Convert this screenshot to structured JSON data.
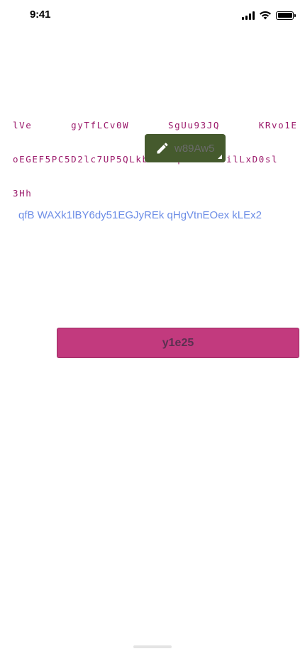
{
  "status_bar": {
    "time": "9:41",
    "icons": [
      "cellular-signal-icon",
      "wifi-icon",
      "battery-icon"
    ]
  },
  "text_block": {
    "lines": [
      "lVe      gyTfLCv0W      SgUu93JQ      KRvo1E",
      "oEGEF5PC5D2lc7UP5QLkbGhKBqHV16xaBilLxD0sl",
      "3Hh"
    ],
    "color": "#9b1a6b"
  },
  "edit_button": {
    "label": "w89Aw5",
    "icon": "pencil-icon",
    "background": "#455a2d"
  },
  "link": {
    "text": "qfB WAXk1lBY6dy51EGJyREk qHgVtnEOex kLEx2",
    "color": "#6c8de6"
  },
  "primary_button": {
    "label": "y1e25",
    "background": "#c23a7e"
  }
}
